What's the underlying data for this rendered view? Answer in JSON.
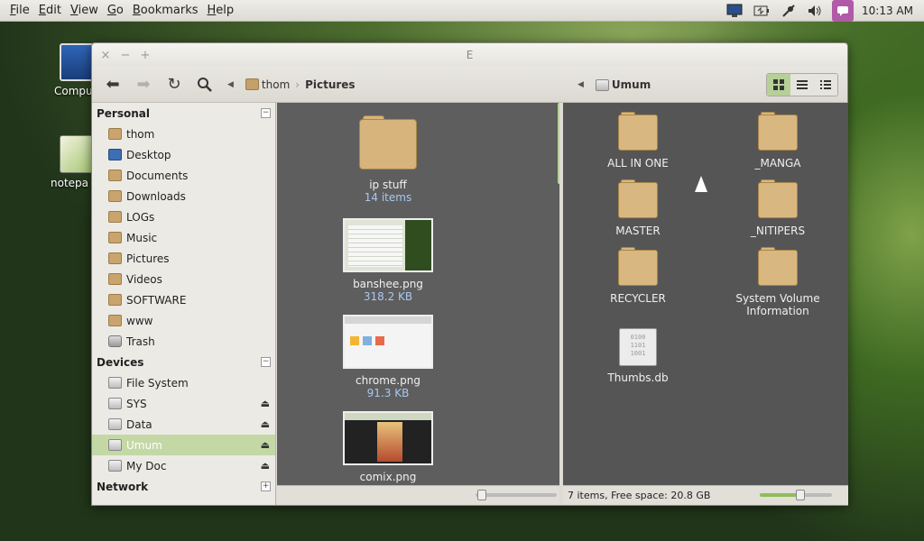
{
  "menubar": {
    "items": [
      {
        "accel": "F",
        "rest": "ile"
      },
      {
        "accel": "E",
        "rest": "dit"
      },
      {
        "accel": "V",
        "rest": "iew"
      },
      {
        "accel": "G",
        "rest": "o"
      },
      {
        "accel": "B",
        "rest": "ookmarks"
      },
      {
        "accel": "H",
        "rest": "elp"
      }
    ]
  },
  "tray": {
    "clock": "10:13 AM"
  },
  "desktop": {
    "icons": [
      {
        "label": "Compu"
      },
      {
        "label": "notepa"
      }
    ]
  },
  "window": {
    "title": "E",
    "close": "×",
    "minimize": "−",
    "maximize": "+"
  },
  "toolbar": {
    "back": "⬅",
    "forward": "➡",
    "reload": "↻",
    "search": "⚲"
  },
  "left_path": {
    "segments": [
      "thom",
      "Pictures"
    ]
  },
  "right_path": {
    "segments": [
      "Umum"
    ]
  },
  "sidebar": {
    "personal": {
      "title": "Personal",
      "collapse": "−",
      "items": [
        "thom",
        "Desktop",
        "Documents",
        "Downloads",
        "LOGs",
        "Music",
        "Pictures",
        "Videos",
        "SOFTWARE",
        "www",
        "Trash"
      ]
    },
    "devices": {
      "title": "Devices",
      "collapse": "−",
      "items": [
        "File System",
        "SYS",
        "Data",
        "Umum",
        "My Doc"
      ]
    },
    "network": {
      "title": "Network",
      "collapse": "+"
    }
  },
  "left_pane": {
    "folder": {
      "name": "ip stuff",
      "sub": "14 items"
    },
    "files": [
      {
        "name": "banshee.png",
        "sub": "318.2 KB"
      },
      {
        "name": "chrome.png",
        "sub": "91.3 KB"
      },
      {
        "name": "comix.png",
        "sub": ""
      }
    ]
  },
  "right_pane": {
    "items": [
      {
        "name": "ALL IN ONE"
      },
      {
        "name": "_MANGA"
      },
      {
        "name": "MASTER"
      },
      {
        "name": "_NITIPERS"
      },
      {
        "name": "RECYCLER"
      },
      {
        "name": "System Volume Information"
      },
      {
        "name": "Thumbs.db"
      }
    ],
    "db_glyph": "0100\n1101\n1001",
    "status": "7 items, Free space: 20.8 GB"
  },
  "zoom": {
    "left_level": 0.0,
    "right_level": 0.5
  }
}
